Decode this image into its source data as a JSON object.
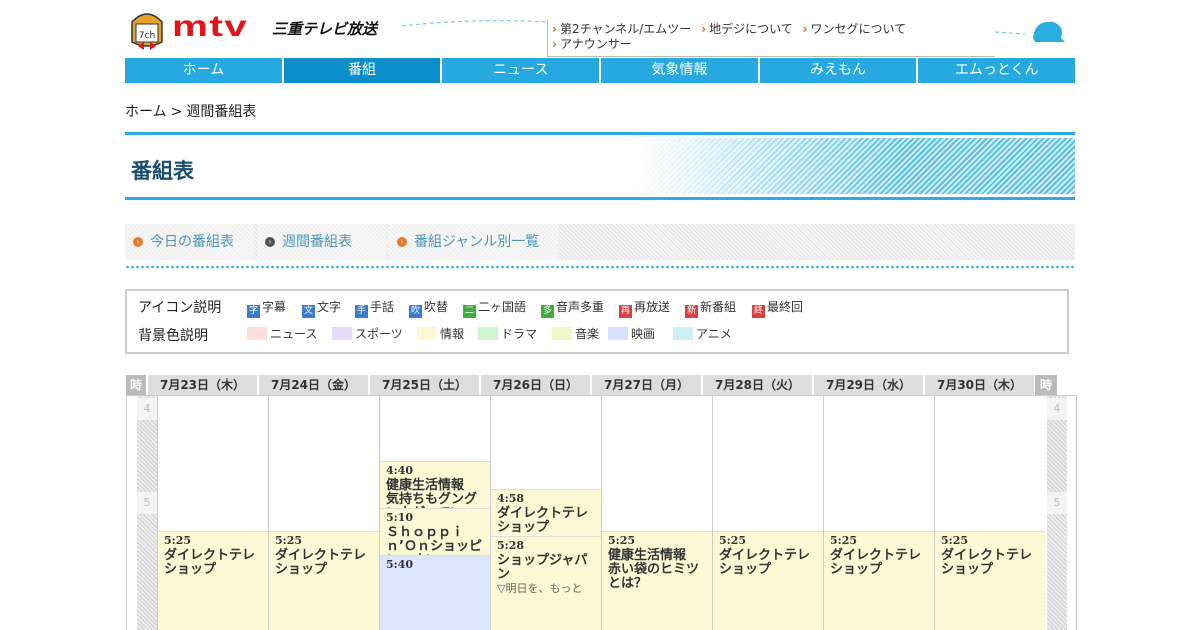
{
  "header": {
    "logo_text": "mtv",
    "logo_mark_text": "7ch",
    "logo_sub": "三重テレビ放送",
    "top_links": [
      "第2チャンネル/エムツー",
      "地デジについて",
      "ワンセグについて",
      "アナウンサー"
    ]
  },
  "nav": [
    {
      "label": "ホーム",
      "active": false
    },
    {
      "label": "番組",
      "active": true
    },
    {
      "label": "ニュース",
      "active": false
    },
    {
      "label": "気象情報",
      "active": false
    },
    {
      "label": "みえもん",
      "active": false
    },
    {
      "label": "エムっとくん",
      "active": false
    }
  ],
  "breadcrumb": {
    "home": "ホーム",
    "sep": ">",
    "current": "週間番組表"
  },
  "page_title": "番組表",
  "tabs": [
    "今日の番組表",
    "週間番組表",
    "番組ジャンル別一覧"
  ],
  "legend": {
    "icon_heading": "アイコン説明",
    "bg_heading": "背景色説明",
    "icons": [
      {
        "glyph": "字",
        "label": "字幕",
        "color": "#3a7ccf"
      },
      {
        "glyph": "文",
        "label": "文字",
        "color": "#3a7ccf"
      },
      {
        "glyph": "手",
        "label": "手話",
        "color": "#3a7ccf"
      },
      {
        "glyph": "吹",
        "label": "吹替",
        "color": "#3a7ccf"
      },
      {
        "glyph": "二",
        "label": "二ヶ国語",
        "color": "#3fae3f"
      },
      {
        "glyph": "多",
        "label": "音声多重",
        "color": "#3fae3f"
      },
      {
        "glyph": "再",
        "label": "再放送",
        "color": "#d94040"
      },
      {
        "glyph": "新",
        "label": "新番組",
        "color": "#d94040"
      },
      {
        "glyph": "終",
        "label": "最終回",
        "color": "#d94040"
      }
    ],
    "colors": [
      {
        "label": "ニュース",
        "color": "#ffdddd"
      },
      {
        "label": "スポーツ",
        "color": "#e6dcf8"
      },
      {
        "label": "情報",
        "color": "#fff8d5"
      },
      {
        "label": "ドラマ",
        "color": "#d0f5d0"
      },
      {
        "label": "音楽",
        "color": "#f0f8c8"
      },
      {
        "label": "映画",
        "color": "#d8e0ff"
      },
      {
        "label": "アニメ",
        "color": "#cdeff8"
      }
    ]
  },
  "schedule": {
    "time_label": "時",
    "hours": [
      "4",
      "5"
    ],
    "days": [
      {
        "date": "7月23日（木）",
        "programs": [
          {
            "start_min": 325,
            "time": "5:25",
            "title": "ダイレクトテレショップ",
            "desc": ""
          }
        ]
      },
      {
        "date": "7月24日（金）",
        "programs": [
          {
            "start_min": 325,
            "time": "5:25",
            "title": "ダイレクトテレショップ",
            "desc": ""
          }
        ]
      },
      {
        "date": "7月25日（土）",
        "programs": [
          {
            "start_min": 280,
            "time": "4:40",
            "title": "健康生活情報　気持ちもグングン上がっていく！目指せ！アゲ肌",
            "desc": ""
          },
          {
            "start_min": 310,
            "time": "5:10",
            "title": "Ｓｈｏｐｐｉｎ’Ｏｎショッピン・オン",
            "desc": ""
          },
          {
            "start_min": 340,
            "time": "5:40",
            "title": "",
            "desc": ""
          }
        ]
      },
      {
        "date": "7月26日（日）",
        "programs": [
          {
            "start_min": 298,
            "time": "4:58",
            "title": "ダイレクトテレショップ",
            "desc": ""
          },
          {
            "start_min": 328,
            "time": "5:28",
            "title": "ショップジャパン",
            "desc": "▽明日を、もっと"
          }
        ]
      },
      {
        "date": "7月27日（月）",
        "programs": [
          {
            "start_min": 325,
            "time": "5:25",
            "title": "健康生活情報　赤い袋のヒミツとは？",
            "desc": ""
          }
        ]
      },
      {
        "date": "7月28日（火）",
        "programs": [
          {
            "start_min": 325,
            "time": "5:25",
            "title": "ダイレクトテレショップ",
            "desc": ""
          }
        ]
      },
      {
        "date": "7月29日（水）",
        "programs": [
          {
            "start_min": 325,
            "time": "5:25",
            "title": "ダイレクトテレショップ",
            "desc": ""
          }
        ]
      },
      {
        "date": "7月30日（木）",
        "programs": [
          {
            "start_min": 325,
            "time": "5:25",
            "title": "ダイレクトテレショップ",
            "desc": ""
          }
        ]
      }
    ]
  }
}
